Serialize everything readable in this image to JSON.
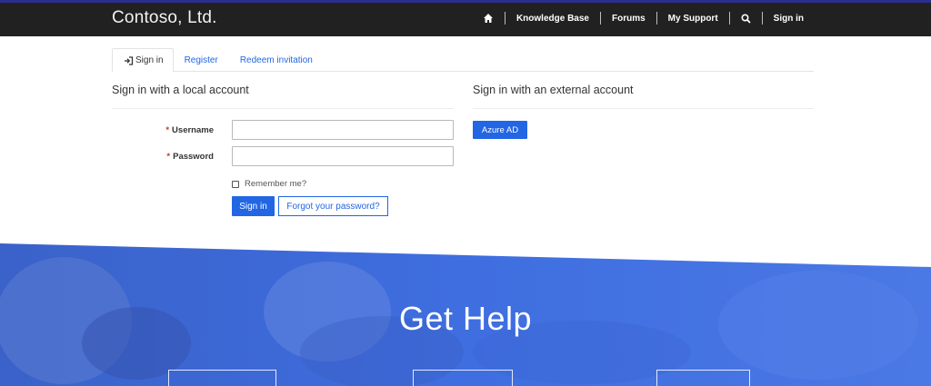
{
  "header": {
    "brand": "Contoso, Ltd.",
    "nav": {
      "home_icon": "home-icon",
      "knowledge_base": "Knowledge Base",
      "forums": "Forums",
      "my_support": "My Support",
      "search_icon": "search-icon",
      "sign_in": "Sign in"
    },
    "colors": {
      "bar": "#212121",
      "accent": "#2a2f8f"
    }
  },
  "tabs": [
    {
      "label": "Sign in",
      "icon": "sign-in-icon",
      "active": true
    },
    {
      "label": "Register",
      "active": false
    },
    {
      "label": "Redeem invitation",
      "active": false
    }
  ],
  "local_account": {
    "title": "Sign in with a local account",
    "username_label": "Username",
    "password_label": "Password",
    "required_marker": "*",
    "remember_label": "Remember me?",
    "sign_in_button": "Sign in",
    "forgot_button": "Forgot your password?"
  },
  "external_account": {
    "title": "Sign in with an external account",
    "azure_button": "Azure AD"
  },
  "hero": {
    "title": "Get Help",
    "color": "#3d6fe0"
  },
  "colors": {
    "primary": "#2266e3",
    "required": "#c0392b"
  }
}
